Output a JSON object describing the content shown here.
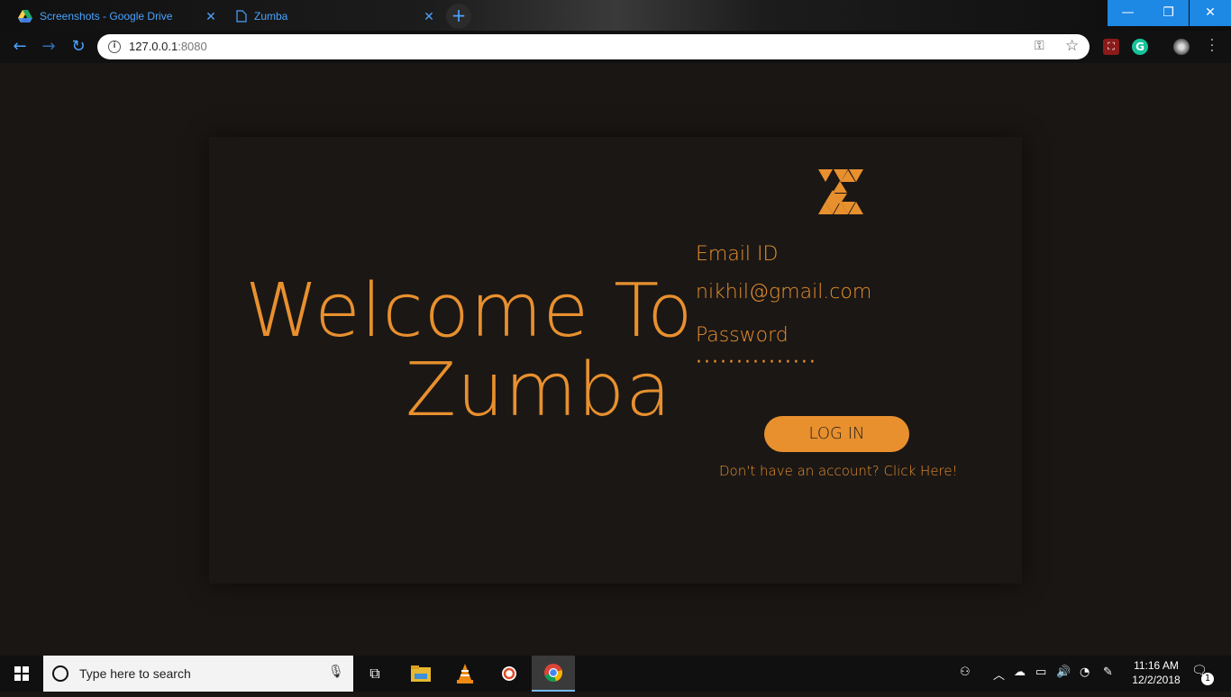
{
  "browser": {
    "tabs": [
      {
        "title": "Screenshots - Google Drive",
        "icon": "google-drive-icon"
      },
      {
        "title": "Zumba",
        "icon": "document-icon"
      }
    ],
    "new_tab": "+",
    "url_host": "127.0.0.1",
    "url_port": ":8080",
    "accent": "#4aa3ff"
  },
  "page": {
    "welcome_line1": "Welcome To",
    "welcome_line2": "Zumba",
    "email_label": "Email ID",
    "email_value": "nikhil@gmail.com",
    "password_label": "Password",
    "password_value": "···············",
    "login_label": "LOG IN",
    "signup_text": "Don't have an account? Click Here!",
    "accent": "#e8902e",
    "background": "#1a1614"
  },
  "taskbar": {
    "search_placeholder": "Type here to search",
    "time": "11:16 AM",
    "date": "12/2/2018",
    "notification_count": "1"
  }
}
